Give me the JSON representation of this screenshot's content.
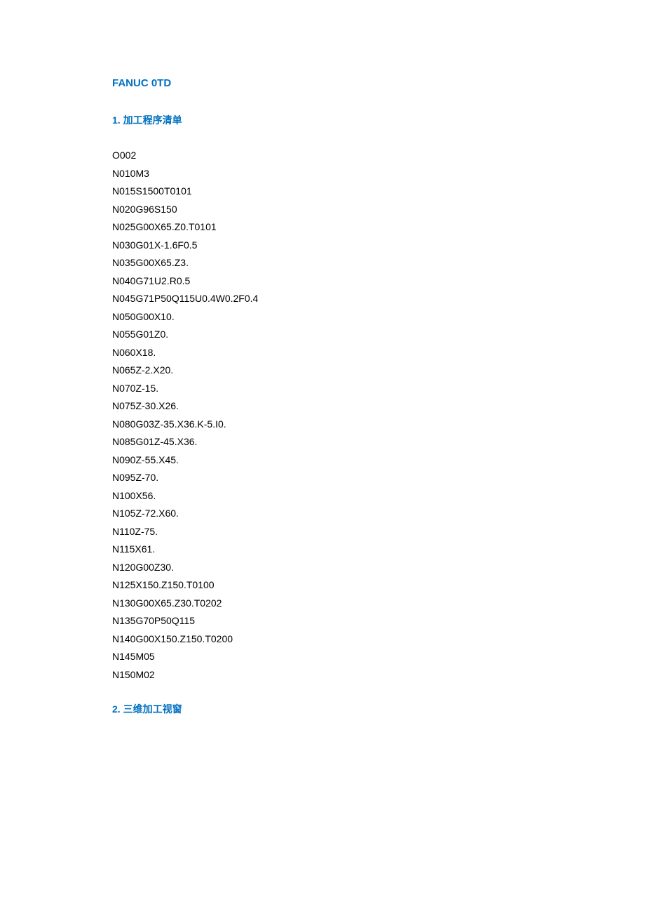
{
  "title": "FANUC 0TD",
  "section1": {
    "heading": "1. 加工程序清单",
    "lines": [
      "O002",
      "N010M3",
      "N015S1500T0101",
      "N020G96S150",
      "N025G00X65.Z0.T0101",
      "N030G01X-1.6F0.5",
      "N035G00X65.Z3.",
      "N040G71U2.R0.5",
      "N045G71P50Q115U0.4W0.2F0.4",
      "N050G00X10.",
      "N055G01Z0.",
      "N060X18.",
      "N065Z-2.X20.",
      "N070Z-15.",
      "N075Z-30.X26.",
      "N080G03Z-35.X36.K-5.I0.",
      "N085G01Z-45.X36.",
      "N090Z-55.X45.",
      "N095Z-70.",
      "N100X56.",
      "N105Z-72.X60.",
      "N110Z-75.",
      "N115X61.",
      "N120G00Z30.",
      "N125X150.Z150.T0100",
      "N130G00X65.Z30.T0202",
      "N135G70P50Q115",
      "N140G00X150.Z150.T0200",
      "N145M05",
      "N150M02"
    ]
  },
  "section2": {
    "heading": "2. 三维加工视窗"
  }
}
